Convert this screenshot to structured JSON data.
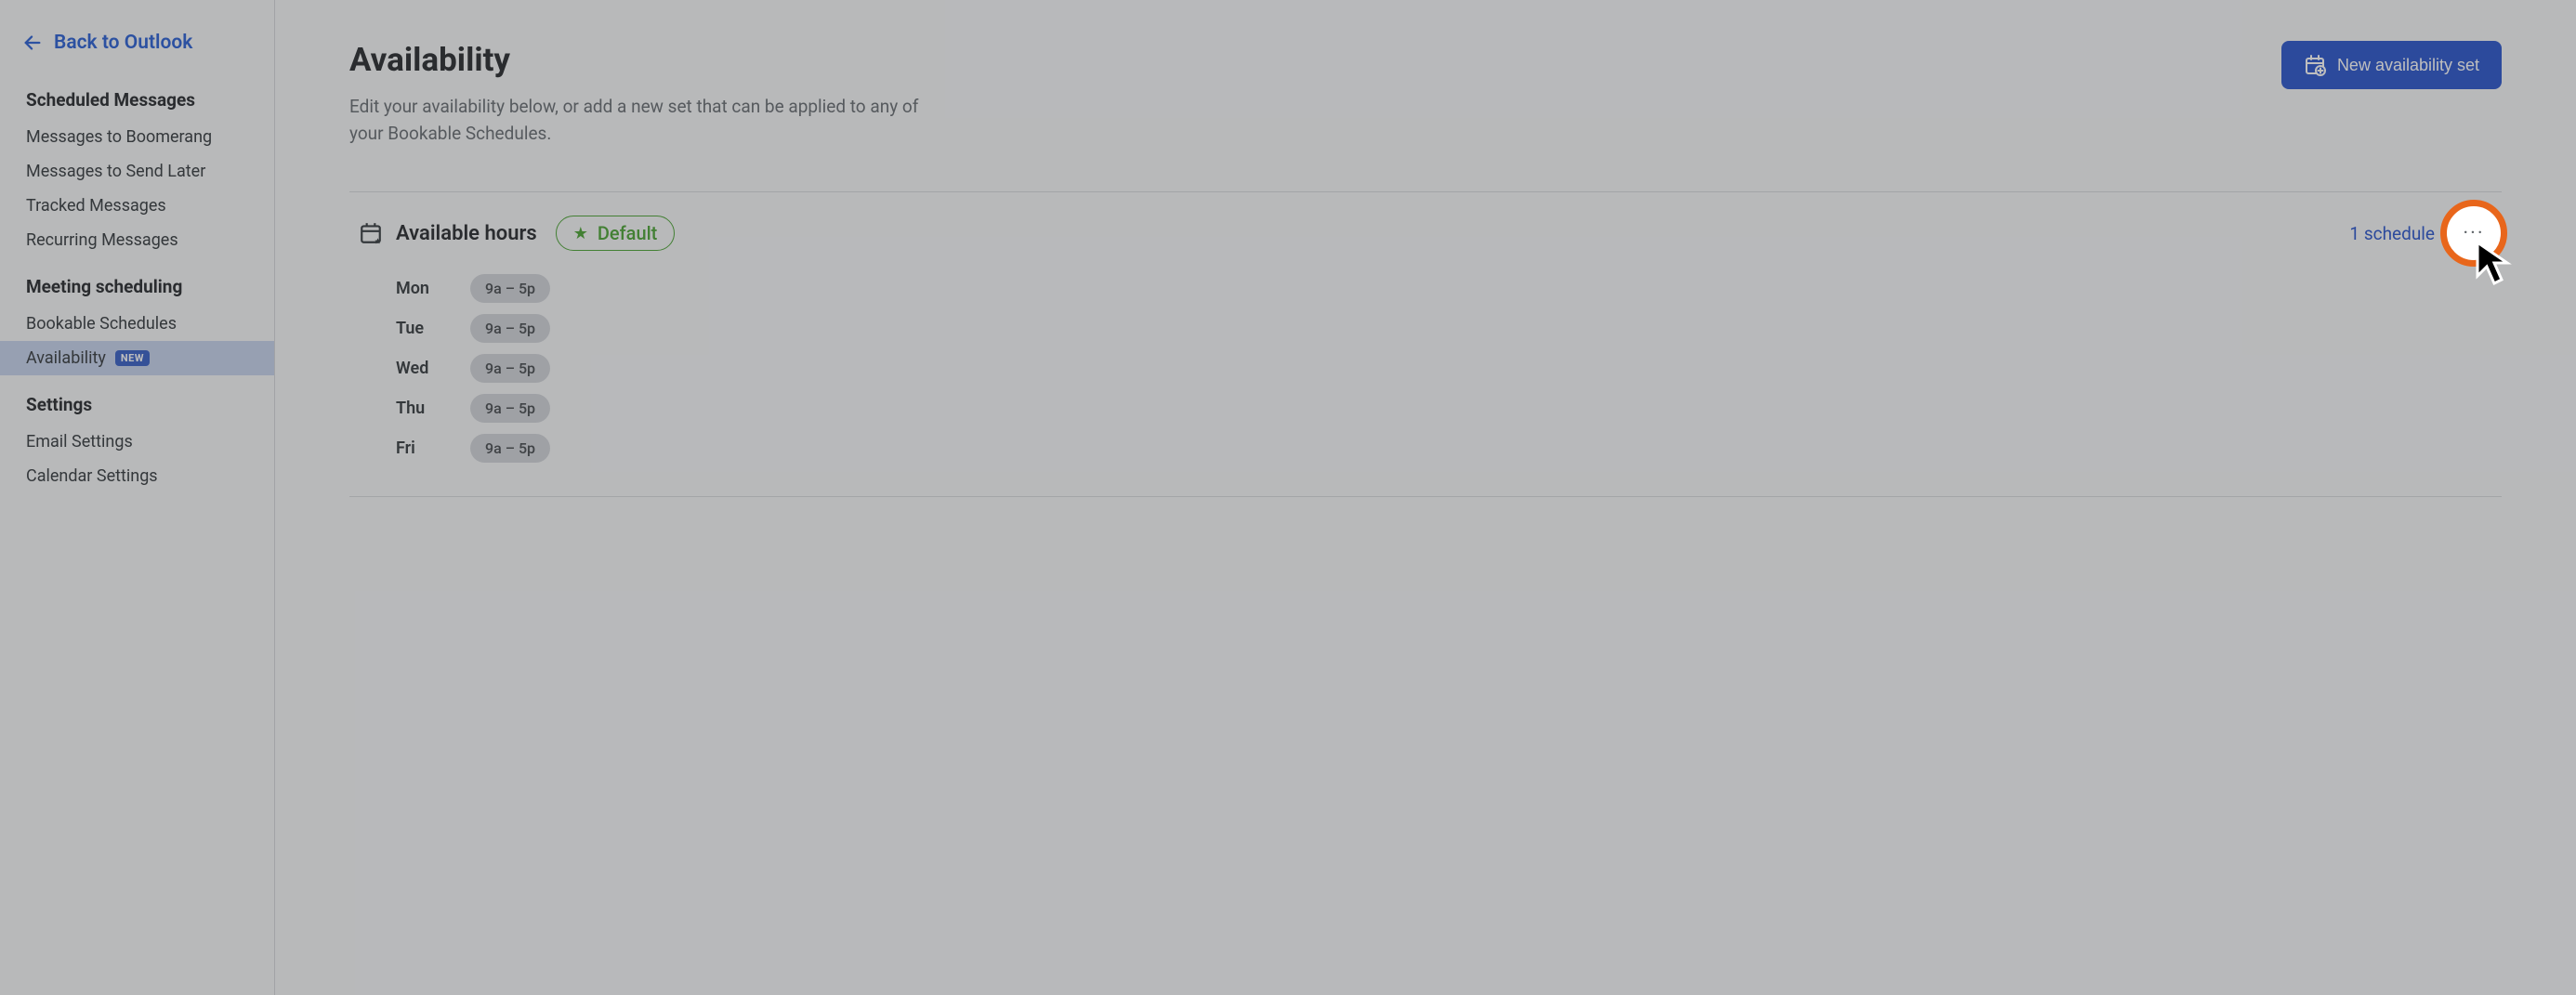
{
  "sidebar": {
    "back_label": "Back to Outlook",
    "sections": {
      "scheduled": {
        "heading": "Scheduled Messages",
        "items": [
          "Messages to Boomerang",
          "Messages to Send Later",
          "Tracked Messages",
          "Recurring Messages"
        ]
      },
      "meeting": {
        "heading": "Meeting scheduling",
        "items": [
          {
            "label": "Bookable Schedules",
            "new": false,
            "active": false
          },
          {
            "label": "Availability",
            "new": true,
            "active": true
          }
        ],
        "new_badge": "NEW"
      },
      "settings": {
        "heading": "Settings",
        "items": [
          "Email Settings",
          "Calendar Settings"
        ]
      }
    }
  },
  "header": {
    "title": "Availability",
    "description": "Edit your availability below, or add a new set that can be applied to any of your Bookable Schedules.",
    "new_button": "New availability set"
  },
  "availability_set": {
    "title": "Available hours",
    "default_label": "Default",
    "schedule_count_label": "1 schedule",
    "more_glyph": "···",
    "days": [
      {
        "day": "Mon",
        "range": "9a – 5p"
      },
      {
        "day": "Tue",
        "range": "9a – 5p"
      },
      {
        "day": "Wed",
        "range": "9a – 5p"
      },
      {
        "day": "Thu",
        "range": "9a – 5p"
      },
      {
        "day": "Fri",
        "range": "9a – 5p"
      }
    ]
  },
  "colors": {
    "accent_blue": "#2f59cf",
    "highlight_orange": "#e8661b",
    "success_green": "#4fa63a"
  }
}
